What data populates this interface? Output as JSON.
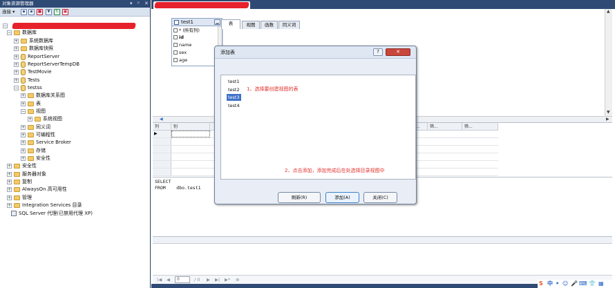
{
  "object_explorer": {
    "title": "对象资源管理器",
    "title_controls": [
      "▾",
      "ᵖ",
      "✕"
    ],
    "connect_label": "连接 ▾",
    "toolbar_icons": [
      "connect-icon",
      "disconnect-icon",
      "stop-icon",
      "filter-icon",
      "refresh-icon",
      "report-icon"
    ],
    "tree": [
      {
        "label": "数据库",
        "exp": "⊟",
        "icon": "folder"
      },
      {
        "label": "系统数据库",
        "exp": "⊞",
        "icon": "folder"
      },
      {
        "label": "数据库快照",
        "exp": "⊞",
        "icon": "folder"
      },
      {
        "label": "ReportServer",
        "exp": "⊞",
        "icon": "db"
      },
      {
        "label": "ReportServerTempDB",
        "exp": "⊞",
        "icon": "db"
      },
      {
        "label": "TestMovie",
        "exp": "⊞",
        "icon": "db"
      },
      {
        "label": "Tests",
        "exp": "⊞",
        "icon": "db"
      },
      {
        "label": "testss",
        "exp": "⊟",
        "icon": "db"
      },
      {
        "label": "数据库关系图",
        "exp": "⊞",
        "icon": "folder"
      },
      {
        "label": "表",
        "exp": "⊞",
        "icon": "folder"
      },
      {
        "label": "视图",
        "exp": "⊟",
        "icon": "folder"
      },
      {
        "label": "系统视图",
        "exp": "⊞",
        "icon": "folder"
      },
      {
        "label": "同义词",
        "exp": "⊞",
        "icon": "folder"
      },
      {
        "label": "可编程性",
        "exp": "⊞",
        "icon": "folder"
      },
      {
        "label": "Service Broker",
        "exp": "⊞",
        "icon": "folder"
      },
      {
        "label": "存储",
        "exp": "⊞",
        "icon": "folder"
      },
      {
        "label": "安全性",
        "exp": "⊞",
        "icon": "folder"
      },
      {
        "label": "安全性",
        "exp": "⊞",
        "icon": "folder"
      },
      {
        "label": "服务器对象",
        "exp": "⊞",
        "icon": "folder"
      },
      {
        "label": "复制",
        "exp": "⊞",
        "icon": "folder"
      },
      {
        "label": "AlwaysOn 高可用性",
        "exp": "⊞",
        "icon": "folder"
      },
      {
        "label": "管理",
        "exp": "⊞",
        "icon": "folder"
      },
      {
        "label": "Integration Services 目录",
        "exp": "⊞",
        "icon": "folder"
      },
      {
        "label": "SQL Server 代理(已禁用代理 XP)",
        "exp": "",
        "icon": "agent"
      }
    ]
  },
  "designer": {
    "table_box": {
      "title": "test1",
      "columns": [
        "* (所有列)",
        "id",
        "name",
        "sex",
        "age"
      ]
    },
    "grid_headers": [
      "列",
      "别",
      "",
      "",
      "",
      "筛...",
      "筛...",
      "筛..."
    ],
    "sql_lines": [
      "SELECT",
      "FROM    dbo.test1"
    ],
    "nav": {
      "first": "|◀",
      "prev": "◀",
      "page": "0",
      "of": "/ 0",
      "next": "▶",
      "last": "▶|",
      "new": "▶*",
      "stop": "⊗"
    }
  },
  "dialog": {
    "title": "添加表",
    "help": "?",
    "close": "✕",
    "tabs": [
      "表",
      "视图",
      "函数",
      "同义词"
    ],
    "items": [
      "test1",
      "test2",
      "test3",
      "test4"
    ],
    "selected_index": 2,
    "annotation_1": "1、选择要创建视图的表",
    "annotation_2": "2、点击添加，添加完成后在处选择目录视图中",
    "buttons": {
      "refresh": "刷新(R)",
      "add": "添加(A)",
      "close": "关闭(C)"
    }
  },
  "ime_bar": [
    "S",
    "中",
    "•",
    "☺",
    "🎤",
    "⌨",
    "👕",
    "▦"
  ],
  "colors": {
    "frame": "#2f4a75",
    "selection": "#3f72c8",
    "annotation": "#e2302b",
    "redaction": "#e7212b"
  }
}
